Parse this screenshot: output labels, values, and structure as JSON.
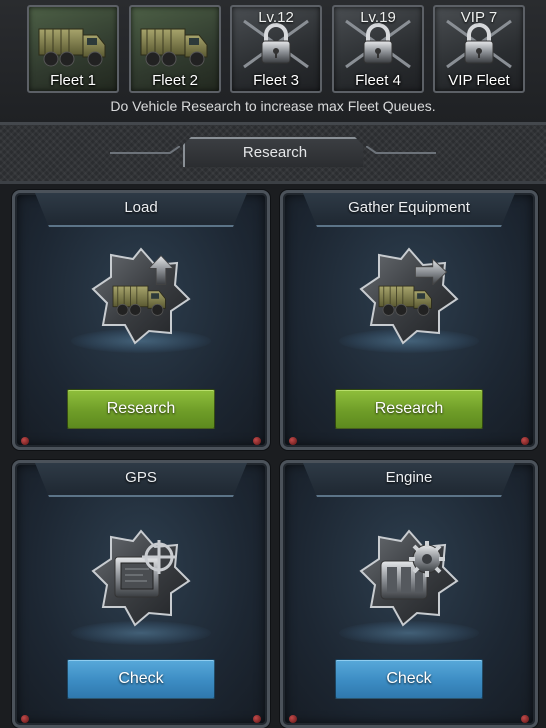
{
  "fleets": [
    {
      "label": "Fleet 1",
      "top_label": "",
      "locked": false,
      "icon": "truck-icon"
    },
    {
      "label": "Fleet 2",
      "top_label": "",
      "locked": false,
      "icon": "truck-icon"
    },
    {
      "label": "Fleet 3",
      "top_label": "Lv.12",
      "locked": true,
      "icon": "lock-icon"
    },
    {
      "label": "Fleet 4",
      "top_label": "Lv.19",
      "locked": true,
      "icon": "lock-icon"
    },
    {
      "label": "VIP Fleet",
      "top_label": "VIP 7",
      "locked": true,
      "icon": "lock-icon"
    }
  ],
  "queue_note": "Do Vehicle Research to increase max Fleet Queues.",
  "section_title": "Research",
  "cards": [
    {
      "title": "Load",
      "icon": "truck-upgrade-icon",
      "button": "Research",
      "button_color": "#7dad2f"
    },
    {
      "title": "Gather Equipment",
      "icon": "gather-truck-icon",
      "button": "Research",
      "button_color": "#7dad2f"
    },
    {
      "title": "GPS",
      "icon": "gps-device-icon",
      "button": "Check",
      "button_color": "#4496cc"
    },
    {
      "title": "Engine",
      "icon": "engine-gear-icon",
      "button": "Check",
      "button_color": "#4496cc"
    }
  ]
}
